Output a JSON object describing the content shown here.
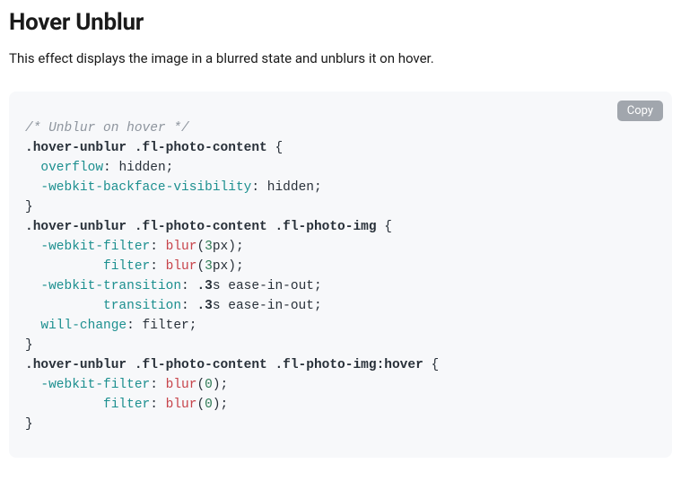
{
  "title": "Hover Unblur",
  "description": "This effect displays the image in a blurred state and unblurs it on hover.",
  "copy_label": "Copy",
  "code": {
    "comment": "/* Unblur on hover */",
    "rules": [
      {
        "selector": ".hover-unblur .fl-photo-content",
        "decls": [
          {
            "prop": "overflow",
            "value": "hidden"
          },
          {
            "prop": "-webkit-backface-visibility",
            "value": "hidden"
          }
        ]
      },
      {
        "selector": ".hover-unblur .fl-photo-content .fl-photo-img",
        "decls": [
          {
            "prop": "-webkit-filter",
            "func": "blur",
            "arg_num": "3",
            "arg_unit": "px"
          },
          {
            "prop": "filter",
            "func": "blur",
            "arg_num": "3",
            "arg_unit": "px",
            "align": true
          },
          {
            "prop": "-webkit-transition",
            "value_parts": [
              ".3",
              "s",
              " ease-in-out"
            ]
          },
          {
            "prop": "transition",
            "value_parts": [
              ".3",
              "s",
              " ease-in-out"
            ],
            "align": true
          },
          {
            "prop": "will-change",
            "value": "filter"
          }
        ]
      },
      {
        "selector": ".hover-unblur .fl-photo-content .fl-photo-img:hover",
        "decls": [
          {
            "prop": "-webkit-filter",
            "func": "blur",
            "arg_num": "0",
            "arg_unit": ""
          },
          {
            "prop": "filter",
            "func": "blur",
            "arg_num": "0",
            "arg_unit": "",
            "align": true
          }
        ]
      }
    ]
  }
}
